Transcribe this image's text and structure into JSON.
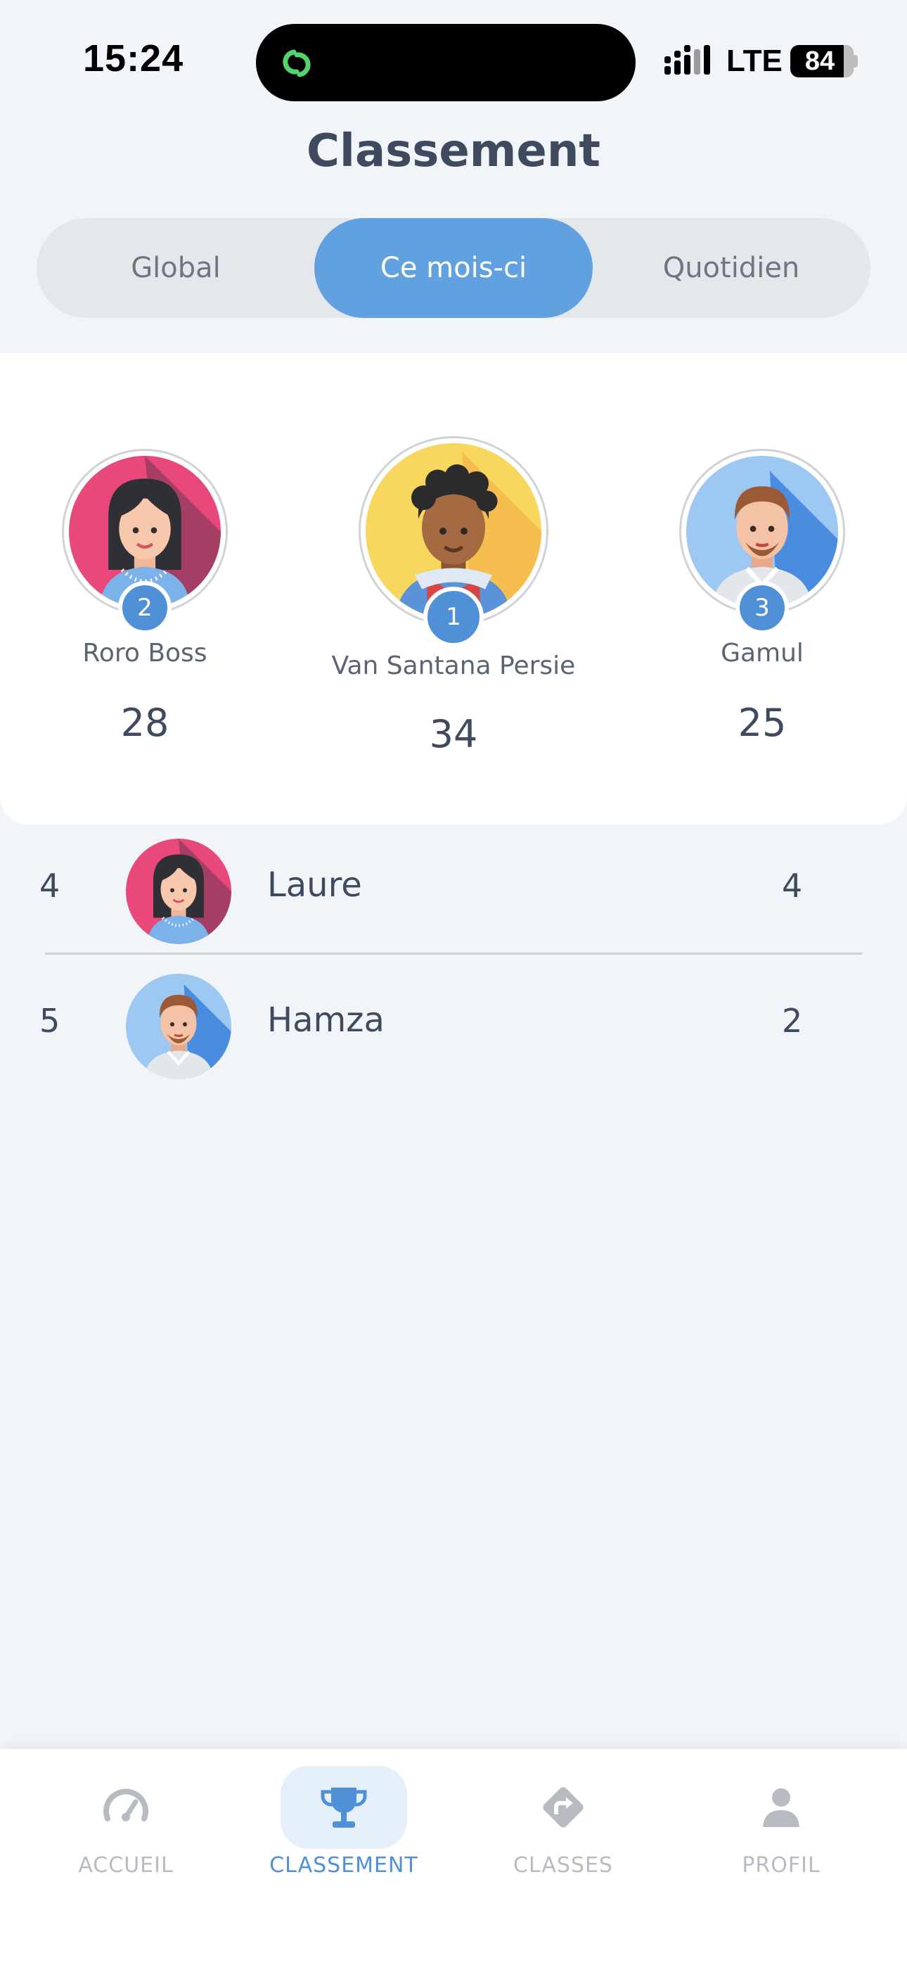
{
  "status_bar": {
    "time": "15:24",
    "network": "LTE",
    "battery": "84",
    "battery_level": 0.84
  },
  "header": {
    "title": "Classement"
  },
  "segments": [
    {
      "label": "Global",
      "active": false
    },
    {
      "label": "Ce mois-ci",
      "active": true
    },
    {
      "label": "Quotidien",
      "active": false
    }
  ],
  "podium": {
    "first": {
      "rank": "1",
      "name": "Van Santana Persie",
      "score": "34"
    },
    "second": {
      "rank": "2",
      "name": "Roro Boss",
      "score": "28"
    },
    "third": {
      "rank": "3",
      "name": "Gamul",
      "score": "25"
    }
  },
  "list": [
    {
      "rank": "4",
      "name": "Laure",
      "score": "4"
    },
    {
      "rank": "5",
      "name": "Hamza",
      "score": "2"
    }
  ],
  "tab_bar": [
    {
      "label": "ACCUEIL",
      "icon": "speedometer-icon",
      "active": false
    },
    {
      "label": "CLASSEMENT",
      "icon": "trophy-icon",
      "active": true
    },
    {
      "label": "CLASSES",
      "icon": "direction-sign-icon",
      "active": false
    },
    {
      "label": "PROFIL",
      "icon": "person-icon",
      "active": false
    }
  ],
  "colors": {
    "accent": "#62a1e0",
    "badge": "#4f90d6",
    "background": "#f1f5f9",
    "text": "#3f4a5e"
  }
}
